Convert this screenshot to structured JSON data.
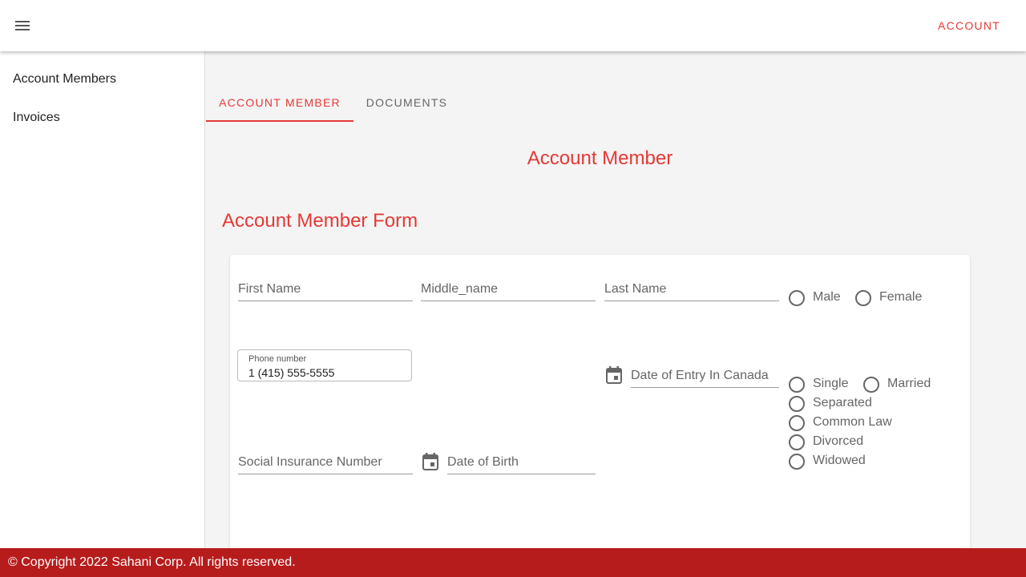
{
  "header": {
    "menu_icon": "hamburger-menu-icon",
    "account_label": "ACCOUNT"
  },
  "sidebar": {
    "items": [
      {
        "label": "Account Members"
      },
      {
        "label": "Invoices"
      }
    ]
  },
  "tabs": [
    {
      "label": "ACCOUNT MEMBER",
      "active": true
    },
    {
      "label": "DOCUMENTS",
      "active": false
    }
  ],
  "main": {
    "heading": "Account Member",
    "form_title": "Account Member Form"
  },
  "form": {
    "first_name_label": "First Name",
    "middle_name_label": "Middle_name",
    "last_name_label": "Last Name",
    "gender_options": [
      "Male",
      "Female"
    ],
    "phone_label": "Phone number",
    "phone_value": "1 (415) 555-5555",
    "date_of_entry_label": "Date of Entry In Canada",
    "marital_options": [
      "Single",
      "Married",
      "Separated",
      "Common Law",
      "Divorced",
      "Widowed"
    ],
    "sin_label": "Social Insurance Number",
    "dob_label": "Date of Birth",
    "calendar_icon": "calendar-icon"
  },
  "footer": {
    "text": "© Copyright 2022 Sahani Corp. All rights reserved."
  },
  "colors": {
    "accent": "#e53935",
    "footer_bg": "#b71c1c"
  }
}
